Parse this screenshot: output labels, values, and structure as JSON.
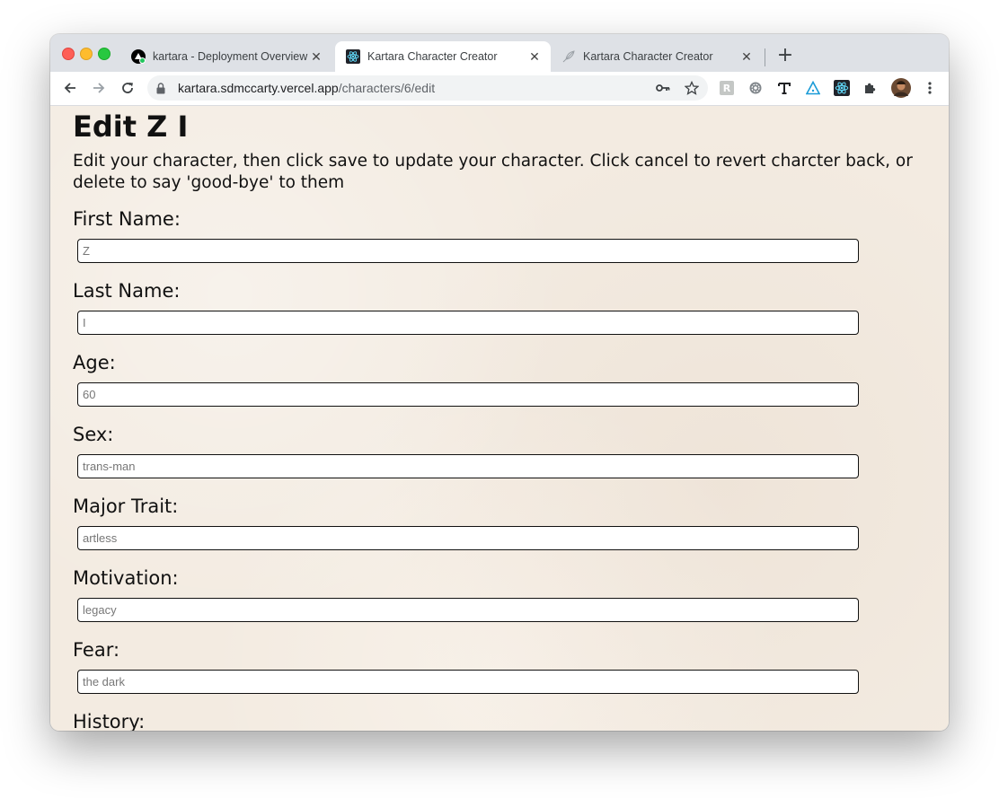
{
  "browser": {
    "tabs": [
      {
        "title": "kartara - Deployment Overview",
        "favicon": "vercel-icon",
        "active": false
      },
      {
        "title": "Kartara Character Creator",
        "favicon": "react-icon",
        "active": true
      },
      {
        "title": "Kartara Character Creator",
        "favicon": "feather-icon",
        "active": false
      }
    ],
    "url_host": "kartara.sdmccarty.vercel.app",
    "url_path": "/characters/6/edit"
  },
  "page": {
    "title": "Edit Z I",
    "intro": "Edit your character, then click save to update your character. Click cancel to revert charcter back, or delete to say 'good-bye' to them",
    "fields": [
      {
        "label": "First Name:",
        "placeholder": "Z"
      },
      {
        "label": "Last Name:",
        "placeholder": "I"
      },
      {
        "label": "Age:",
        "placeholder": "60"
      },
      {
        "label": "Sex:",
        "placeholder": "trans-man"
      },
      {
        "label": "Major Trait:",
        "placeholder": "artless"
      },
      {
        "label": "Motivation:",
        "placeholder": "legacy"
      },
      {
        "label": "Fear:",
        "placeholder": "the dark"
      },
      {
        "label": "History:",
        "placeholder": ""
      }
    ]
  },
  "colors": {
    "page_background": "#f3ebe1",
    "tabstrip": "#dee1e6",
    "text": "#111111"
  }
}
